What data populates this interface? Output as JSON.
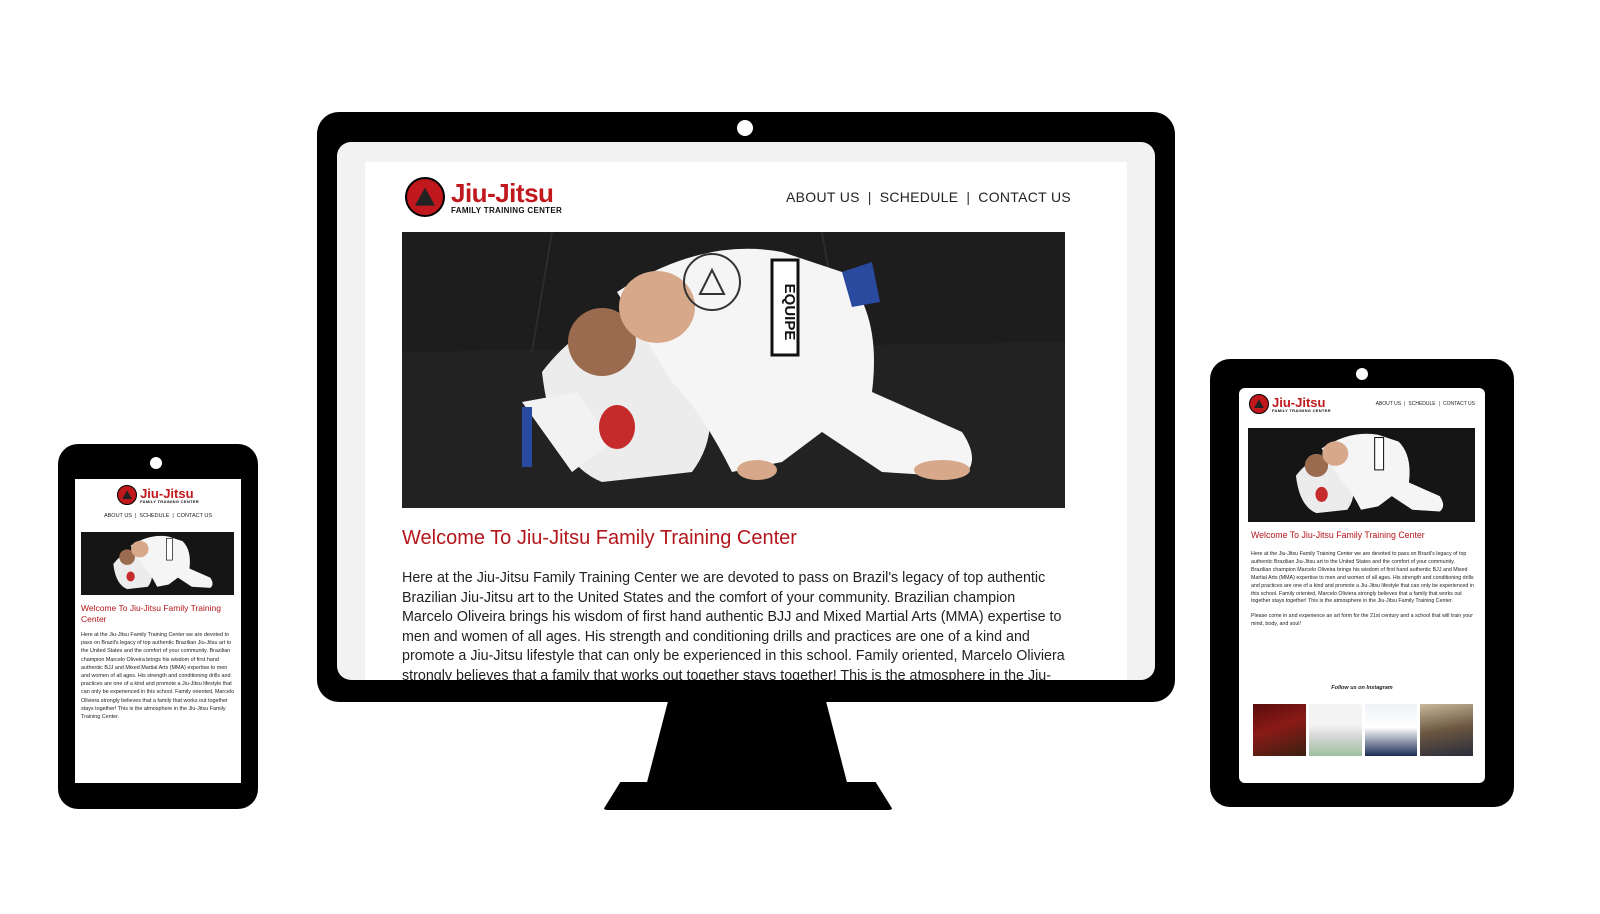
{
  "site": {
    "logo_title": "Jiu-Jitsu",
    "logo_subtitle": "FAMILY TRAINING CENTER",
    "nav": {
      "about": "ABOUT US",
      "schedule": "SCHEDULE",
      "contact": "CONTACT US",
      "separator": "|"
    },
    "welcome_heading": "Welcome To Jiu-Jitsu Family Training Center",
    "intro_paragraph": "Here at the Jiu-Jitsu Family Training Center we are devoted to pass on Brazil's legacy of top authentic Brazilian Jiu-Jitsu art to the United States and the comfort of your community. Brazilian champion Marcelo Oliveira brings his wisdom of first hand authentic BJJ and Mixed Martial Arts (MMA) expertise to men and women of all ages. His strength and conditioning drills and practices are one of a kind and promote a Jiu-Jitsu lifestyle that can only be experienced in this school. Family oriented, Marcelo Oliviera strongly believes that a family that works out together stays together! This is the atmosphere in the Jiu-Jitsu Family Training Center.",
    "second_paragraph": "Please come in and experience an art form for the 21st century and a school that will train your mind, body, and soul!",
    "instagram_heading": "Follow us on Instagram",
    "hero_gi_patch": "EQUIPE"
  },
  "colors": {
    "brand_red": "#c0181c",
    "heading_red": "#b3161b",
    "device_frame": "#000000"
  }
}
